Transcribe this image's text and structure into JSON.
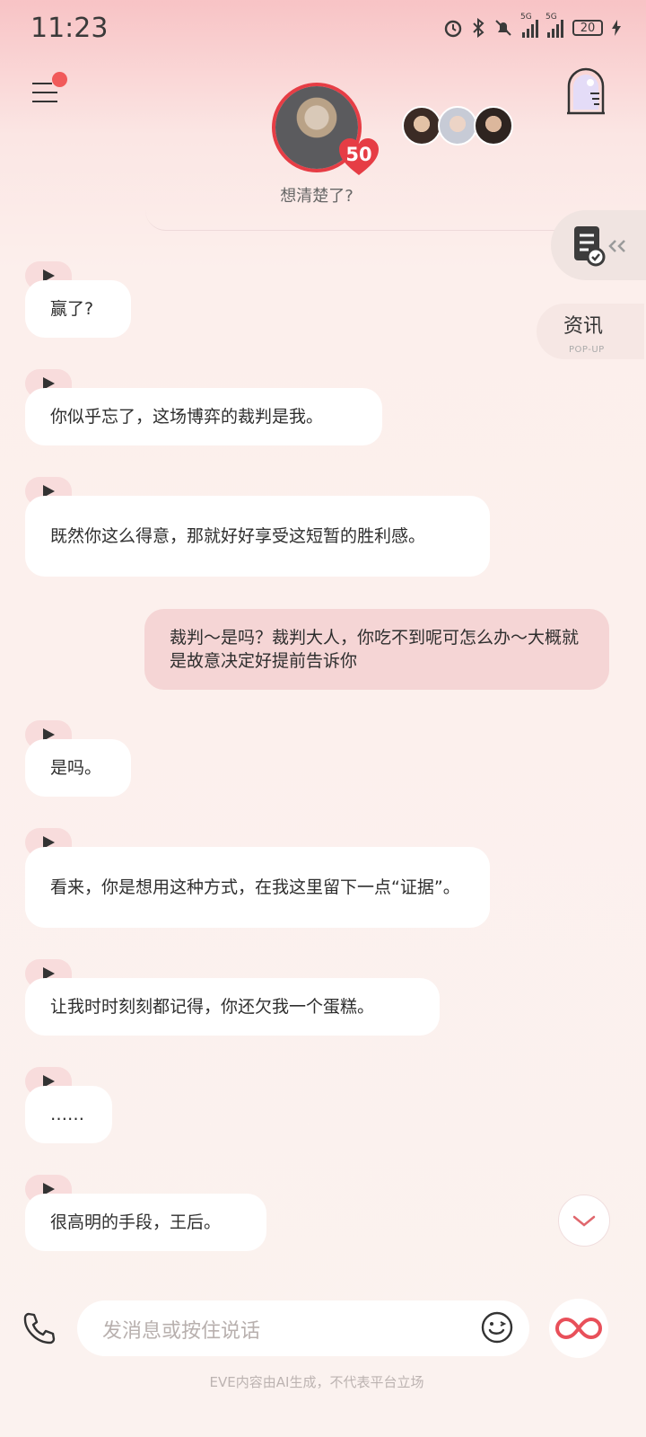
{
  "status_bar": {
    "time": "11:23",
    "net1": "5G",
    "net2": "5G",
    "battery": "20"
  },
  "header": {
    "intimacy_level": "50",
    "subtitle": "想清楚了?"
  },
  "side": {
    "popup_title": "资讯",
    "popup_sub": "POP-UP"
  },
  "messages": [
    {
      "role": "ai",
      "text": "赢了?"
    },
    {
      "role": "ai",
      "text": "你似乎忘了，这场博弈的裁判是我。"
    },
    {
      "role": "ai",
      "text": "既然你这么得意，那就好好享受这短暂的胜利感。"
    },
    {
      "role": "user",
      "text": "裁判～是吗？裁判大人，你吃不到呢可怎么办～大概就是故意决定好提前告诉你"
    },
    {
      "role": "ai",
      "text": "是吗。"
    },
    {
      "role": "ai",
      "text": "看来，你是想用这种方式，在我这里留下一点“证据”。"
    },
    {
      "role": "ai",
      "text": "让我时时刻刻都记得，你还欠我一个蛋糕。"
    },
    {
      "role": "ai",
      "text": "……"
    },
    {
      "role": "ai",
      "text": "很高明的手段，王后。"
    }
  ],
  "input": {
    "placeholder": "发消息或按住说话"
  },
  "footer": {
    "disclaimer": "EVE内容由AI生成，不代表平台立场"
  },
  "colors": {
    "accent": "#e63d45",
    "user_bubble": "#f5d5d5",
    "play_tab": "#f8dcdc"
  },
  "icons": [
    "menu-icon",
    "window-door-icon",
    "heart-icon",
    "report-icon",
    "play-icon",
    "chevron-down-icon",
    "phone-icon",
    "emoji-icon",
    "infinity-icon"
  ]
}
